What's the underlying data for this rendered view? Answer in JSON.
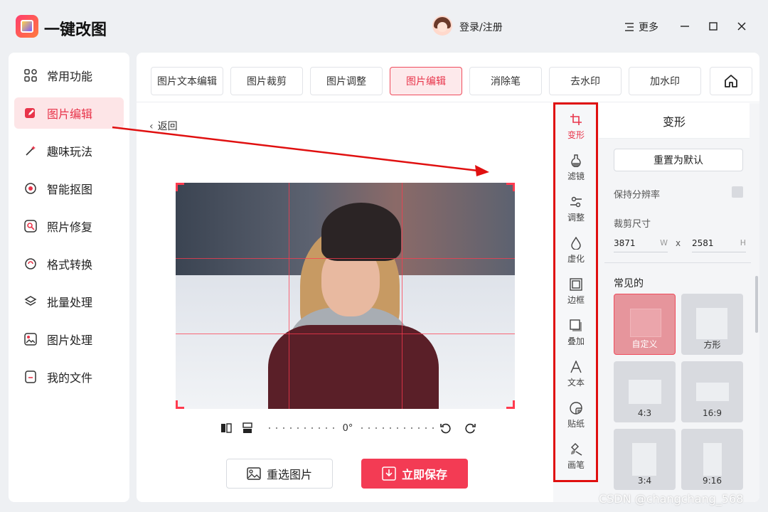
{
  "app": {
    "title": "一键改图",
    "login": "登录/注册",
    "more": "更多"
  },
  "sidebar": {
    "items": [
      {
        "label": "常用功能",
        "icon": "grid-icon"
      },
      {
        "label": "图片编辑",
        "icon": "edit-icon"
      },
      {
        "label": "趣味玩法",
        "icon": "magic-wand-icon"
      },
      {
        "label": "智能抠图",
        "icon": "cutout-icon"
      },
      {
        "label": "照片修复",
        "icon": "repair-icon"
      },
      {
        "label": "格式转换",
        "icon": "convert-icon"
      },
      {
        "label": "批量处理",
        "icon": "layers-icon"
      },
      {
        "label": "图片处理",
        "icon": "image-icon"
      },
      {
        "label": "我的文件",
        "icon": "file-icon"
      }
    ],
    "active_index": 1
  },
  "tabs": [
    "图片文本编辑",
    "图片裁剪",
    "图片调整",
    "图片编辑",
    "消除笔",
    "去水印",
    "加水印"
  ],
  "active_tab": "图片编辑",
  "editor": {
    "back": "返回",
    "rotation": "0°",
    "reselect": "重选图片",
    "save": "立即保存"
  },
  "tools": [
    {
      "label": "变形",
      "icon": "crop-icon"
    },
    {
      "label": "滤镜",
      "icon": "filter-icon"
    },
    {
      "label": "调整",
      "icon": "adjust-icon"
    },
    {
      "label": "虚化",
      "icon": "blur-drop-icon"
    },
    {
      "label": "边框",
      "icon": "frame-icon"
    },
    {
      "label": "叠加",
      "icon": "overlay-icon"
    },
    {
      "label": "文本",
      "icon": "text-icon"
    },
    {
      "label": "贴纸",
      "icon": "sticker-icon"
    },
    {
      "label": "画笔",
      "icon": "brush-icon"
    }
  ],
  "panel": {
    "title": "变形",
    "reset": "重置为默认",
    "keep_resolution": "保持分辨率",
    "crop_size_label": "裁剪尺寸",
    "width": "3871",
    "width_unit": "W",
    "x_sep": "x",
    "height": "2581",
    "height_unit": "H",
    "common_label": "常见的",
    "ratios": [
      {
        "label": "自定义"
      },
      {
        "label": "方形"
      },
      {
        "label": "4:3"
      },
      {
        "label": "16:9"
      },
      {
        "label": "3:4"
      },
      {
        "label": "9:16"
      }
    ]
  },
  "colors": {
    "accent": "#f33b54",
    "annotation_red": "#e01010"
  },
  "watermark": "CSDN @changchang_568"
}
